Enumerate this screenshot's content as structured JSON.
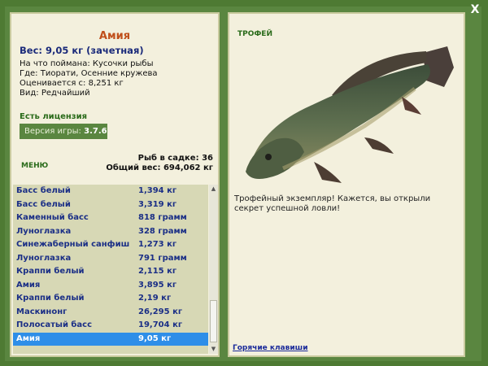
{
  "window": {
    "close_label": "X"
  },
  "fish": {
    "name": "Амия",
    "weight": "Вес: 9,05 кг (зачетная)",
    "bait": "На что поймана: Кусочки рыбы",
    "location": "Где: Тиорати, Осенние кружева",
    "value": "Оценивается с: 8,251 кг",
    "kind": "Вид: Редчайший"
  },
  "license": "Есть лицензия",
  "version": {
    "label": "Версия игры:",
    "value": "3.7.6"
  },
  "menu_label": "МЕНЮ",
  "stats": {
    "count": "Рыб в садке: 36",
    "total": "Общий вес: 694,062 кг"
  },
  "catch_list": [
    {
      "name": "Басс белый",
      "weight": "1,394 кг"
    },
    {
      "name": "Басс белый",
      "weight": "3,319 кг"
    },
    {
      "name": "Каменный басс",
      "weight": "818 грамм"
    },
    {
      "name": "Луноглазка",
      "weight": "328 грамм"
    },
    {
      "name": "Синежаберный санфиш",
      "weight": "1,273 кг"
    },
    {
      "name": "Луноглазка",
      "weight": "791 грамм"
    },
    {
      "name": "Краппи белый",
      "weight": "2,115 кг"
    },
    {
      "name": "Амия",
      "weight": "3,895 кг"
    },
    {
      "name": "Краппи белый",
      "weight": "2,19 кг"
    },
    {
      "name": "Маскинонг",
      "weight": "26,295 кг"
    },
    {
      "name": "Полосатый басс",
      "weight": "19,704 кг"
    },
    {
      "name": "Амия",
      "weight": "9,05 кг"
    }
  ],
  "selected_index": 11,
  "trophy": {
    "label": "ТРОФЕЙ",
    "text": "Трофейный экземпляр! Кажется, вы открыли секрет успешной ловли!"
  },
  "hotkeys_label": "Горячие клавиши",
  "colors": {
    "background": "#4e7a33",
    "panel": "#f3f0dd",
    "accent_orange": "#c0501b",
    "selected_row": "#2e8ee8"
  }
}
